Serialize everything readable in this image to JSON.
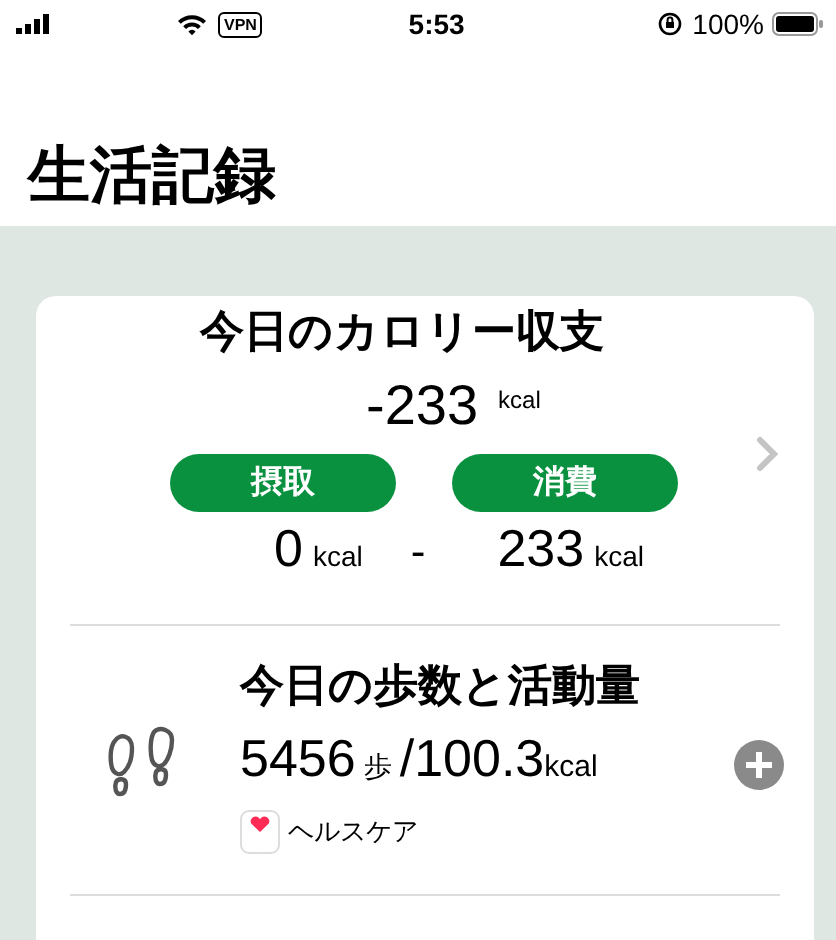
{
  "status_bar": {
    "vpn": "VPN",
    "time": "5:53",
    "battery": "100%"
  },
  "title": "生活記録",
  "calorie": {
    "title": "今日のカロリー収支",
    "balance": "-233",
    "balance_unit": "kcal",
    "intake_label": "摂取",
    "burn_label": "消費",
    "intake": "0",
    "intake_unit": "kcal",
    "minus": "-",
    "burn": "233",
    "burn_unit": "kcal"
  },
  "activity": {
    "title": "今日の歩数と活動量",
    "steps": "5456",
    "steps_unit": "歩",
    "calories": "/100.3",
    "calories_unit": "kcal",
    "source": "ヘルスケア"
  }
}
